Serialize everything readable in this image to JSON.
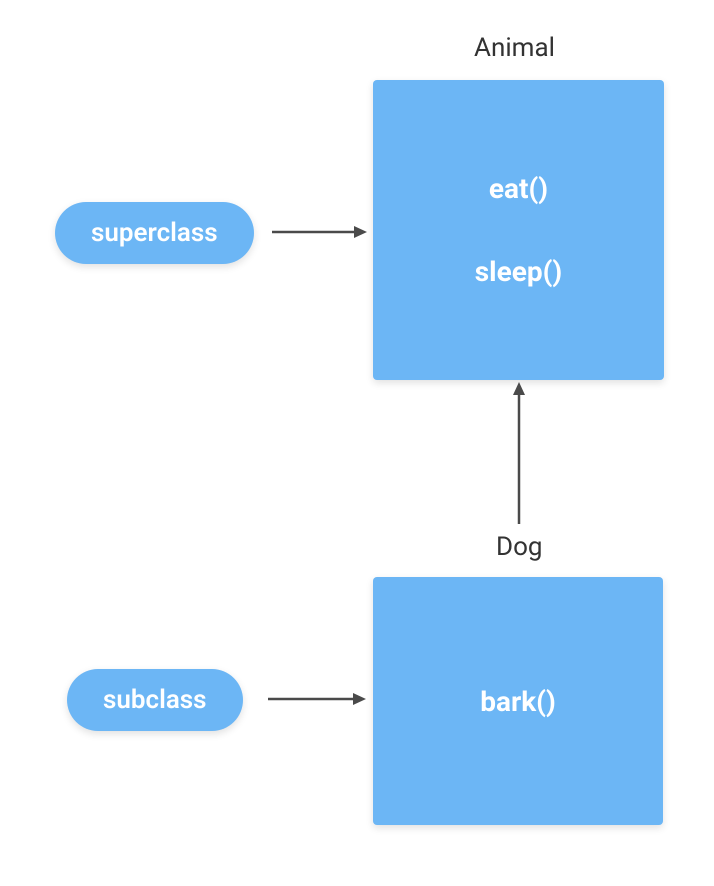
{
  "superclass": {
    "pill_label": "superclass",
    "class_name": "Animal",
    "methods": [
      "eat()",
      "sleep()"
    ]
  },
  "subclass": {
    "pill_label": "subclass",
    "class_name": "Dog",
    "methods": [
      "bark()"
    ]
  },
  "colors": {
    "blue": "#6cb6f5",
    "text": "#333333",
    "arrow": "#4a4a4a"
  }
}
